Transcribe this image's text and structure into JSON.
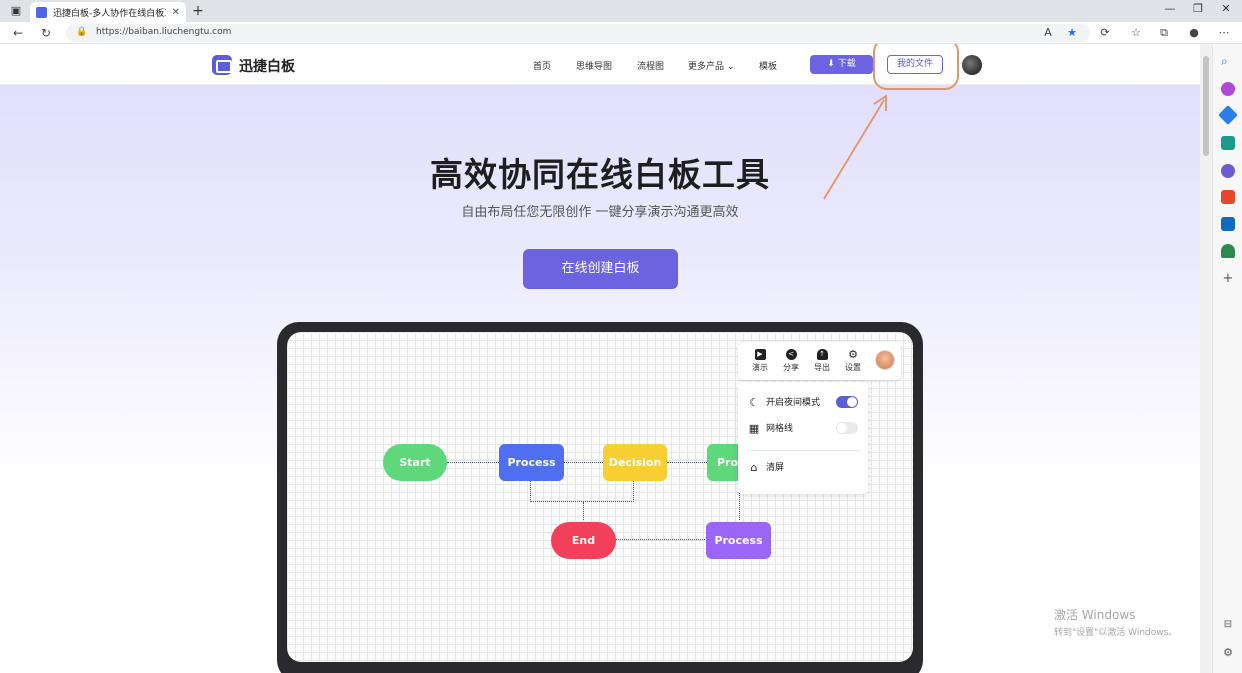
{
  "browser": {
    "tab_title": "迅捷白板-多人协作在线白板工具",
    "url": "https://baiban.liuchengtu.com"
  },
  "site": {
    "logo_text": "迅捷白板",
    "nav": [
      {
        "label": "首页"
      },
      {
        "label": "思维导图"
      },
      {
        "label": "流程图"
      },
      {
        "label": "更多产品"
      },
      {
        "label": "模板"
      }
    ],
    "download_label": "下载",
    "myfiles_label": "我的文件"
  },
  "hero": {
    "title": "高效协同在线白板工具",
    "subtitle": "自由布局任您无限创作 一键分享演示沟通更高效",
    "cta_label": "在线创建白板"
  },
  "whiteboard": {
    "toolbar": [
      {
        "label": "演示",
        "icon": "play-icon"
      },
      {
        "label": "分享",
        "icon": "share-icon"
      },
      {
        "label": "导出",
        "icon": "cloud-upload-icon"
      },
      {
        "label": "设置",
        "icon": "gear-icon"
      }
    ],
    "settings": {
      "night_mode_label": "开启夜间模式",
      "night_mode_on": true,
      "grid_label": "网格线",
      "grid_on": false,
      "clear_label": "清屏"
    },
    "nodes": [
      {
        "id": "start",
        "label": "Start",
        "color": "#5ed87a"
      },
      {
        "id": "process1",
        "label": "Process",
        "color": "#4f6ff0"
      },
      {
        "id": "decision",
        "label": "Decision",
        "color": "#f8cf33"
      },
      {
        "id": "process2",
        "label": "Proc",
        "color": "#5ed87a"
      },
      {
        "id": "end",
        "label": "End",
        "color": "#f2405a"
      },
      {
        "id": "process3",
        "label": "Process",
        "color": "#9b66f5"
      }
    ]
  },
  "colors": {
    "accent": "#6b63e0",
    "highlight_ring": "#e0956a"
  },
  "watermark": {
    "line1": "激活 Windows",
    "line2": "转到\"设置\"以激活 Windows。"
  }
}
